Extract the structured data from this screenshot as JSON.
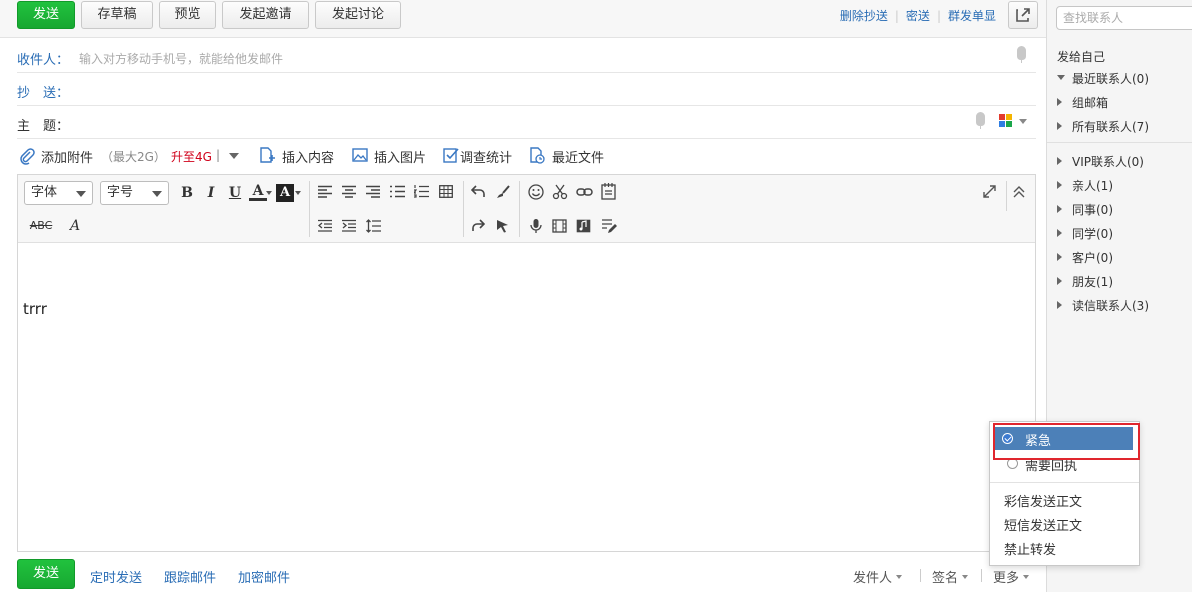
{
  "toolbar": {
    "send": "发送",
    "save_draft": "存草稿",
    "preview": "预览",
    "invite": "发起邀请",
    "discuss": "发起讨论",
    "links": [
      "删除抄送",
      "密送",
      "群发单显"
    ]
  },
  "fields": {
    "to_label": "收件人：",
    "to_placeholder": "输入对方移动手机号，就能给他发邮件",
    "cc_label": "抄　送：",
    "subject_label": "主　题："
  },
  "attach": {
    "add": "添加附件",
    "max": "（最大2G）",
    "upgrade": "升至4G",
    "pipe": "|",
    "insert_content": "插入内容",
    "insert_image": "插入图片",
    "survey": "调查统计",
    "recent_files": "最近文件"
  },
  "editor": {
    "font_select": "字体",
    "size_select": "字号",
    "bold": "B",
    "italic": "I",
    "underline": "U",
    "font_color": "A",
    "bg_color": "A",
    "strike": "ABC",
    "clear_format": "A",
    "body_text": "trrr"
  },
  "bottom": {
    "send": "发送",
    "scheduled": "定时发送",
    "track": "跟踪邮件",
    "encrypt": "加密邮件",
    "sender": "发件人",
    "signature": "签名",
    "more": "更多"
  },
  "sidebar": {
    "search_placeholder": "查找联系人",
    "self": "发给自己",
    "groups_top": [
      "最近联系人(0)",
      "组邮箱",
      "所有联系人(7)"
    ],
    "groups_bottom": [
      "VIP联系人(0)",
      "亲人(1)",
      "同事(0)",
      "同学(0)",
      "客户(0)",
      "朋友(1)",
      "读信联系人(3)"
    ]
  },
  "menu": {
    "urgent": "紧急",
    "receipt": "需要回执",
    "mms_body": "彩信发送正文",
    "sms_body": "短信发送正文",
    "no_forward": "禁止转发"
  },
  "colors": {
    "accent": "#2a6db5",
    "send_green": "#1db436",
    "highlight_blue": "#4c80b8",
    "annotation_red": "#e0262e"
  }
}
